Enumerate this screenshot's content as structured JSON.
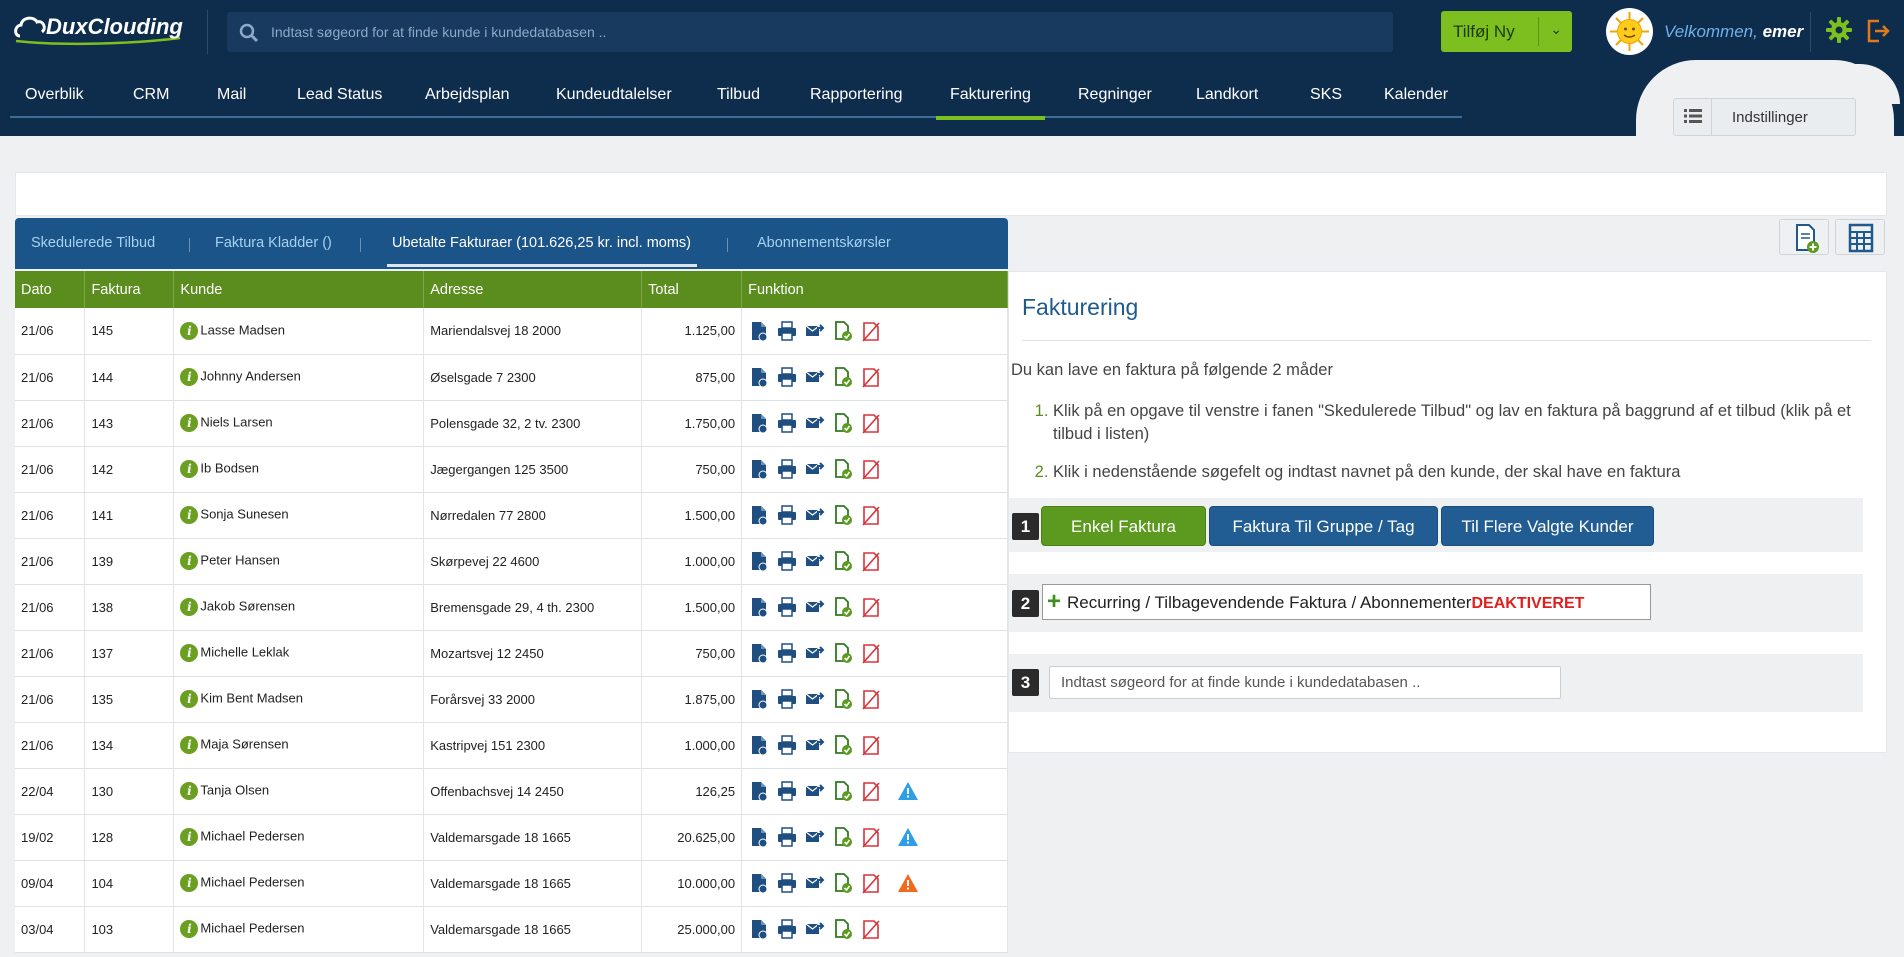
{
  "header": {
    "logo_text": "DuxClouding",
    "search_placeholder": "Indtast søgeord for at finde kunde i kundedatabasen ..",
    "add_new_label": "Tilføj Ny",
    "welcome_prefix": "Velkommen,",
    "welcome_user": "emer"
  },
  "nav": {
    "items": [
      "Overblik",
      "CRM",
      "Mail",
      "Lead Status",
      "Arbejdsplan",
      "Kundeudtalelser",
      "Tilbud",
      "Rapportering",
      "Fakturering",
      "Regninger",
      "Landkort",
      "SKS",
      "Kalender"
    ],
    "active": "Fakturering",
    "settings_label": "Indstillinger"
  },
  "tabs": {
    "items": [
      "Skedulerede Tilbud",
      "Faktura Kladder ()",
      "Ubetalte Fakturaer (101.626,25 kr. incl. moms)",
      "Abonnementskørsler"
    ],
    "active_index": 2
  },
  "table": {
    "headers": [
      "Dato",
      "Faktura",
      "Kunde",
      "Adresse",
      "Total",
      "Funktion"
    ],
    "rows": [
      {
        "dato": "21/06",
        "faktura": "145",
        "kunde": "Lasse Madsen",
        "adresse": "Mariendalsvej 18 2000",
        "total": "1.125,00",
        "warn": ""
      },
      {
        "dato": "21/06",
        "faktura": "144",
        "kunde": "Johnny Andersen",
        "adresse": "Øselsgade 7 2300",
        "total": "875,00",
        "warn": ""
      },
      {
        "dato": "21/06",
        "faktura": "143",
        "kunde": "Niels Larsen",
        "adresse": "Polensgade 32, 2 tv. 2300",
        "total": "1.750,00",
        "warn": ""
      },
      {
        "dato": "21/06",
        "faktura": "142",
        "kunde": "Ib Bodsen",
        "adresse": "Jægergangen 125 3500",
        "total": "750,00",
        "warn": ""
      },
      {
        "dato": "21/06",
        "faktura": "141",
        "kunde": "Sonja Sunesen",
        "adresse": "Nørredalen 77 2800",
        "total": "1.500,00",
        "warn": ""
      },
      {
        "dato": "21/06",
        "faktura": "139",
        "kunde": "Peter Hansen",
        "adresse": "Skørpevej 22 4600",
        "total": "1.000,00",
        "warn": ""
      },
      {
        "dato": "21/06",
        "faktura": "138",
        "kunde": "Jakob Sørensen",
        "adresse": "Bremensgade 29, 4 th. 2300",
        "total": "1.500,00",
        "warn": ""
      },
      {
        "dato": "21/06",
        "faktura": "137",
        "kunde": "Michelle Leklak",
        "adresse": "Mozartsvej 12 2450",
        "total": "750,00",
        "warn": ""
      },
      {
        "dato": "21/06",
        "faktura": "135",
        "kunde": "Kim Bent Madsen",
        "adresse": "Forårsvej 33 2000",
        "total": "1.875,00",
        "warn": ""
      },
      {
        "dato": "21/06",
        "faktura": "134",
        "kunde": "Maja Sørensen",
        "adresse": "Kastripvej 151 2300",
        "total": "1.000,00",
        "warn": ""
      },
      {
        "dato": "22/04",
        "faktura": "130",
        "kunde": "Tanja Olsen",
        "adresse": "Offenbachsvej 14 2450",
        "total": "126,25",
        "warn": "blue"
      },
      {
        "dato": "19/02",
        "faktura": "128",
        "kunde": "Michael Pedersen",
        "adresse": "Valdemarsgade 18 1665",
        "total": "20.625,00",
        "warn": "blue"
      },
      {
        "dato": "09/04",
        "faktura": "104",
        "kunde": "Michael Pedersen",
        "adresse": "Valdemarsgade 18 1665",
        "total": "10.000,00",
        "warn": "orange"
      },
      {
        "dato": "03/04",
        "faktura": "103",
        "kunde": "Michael Pedersen",
        "adresse": "Valdemarsgade 18 1665",
        "total": "25.000,00",
        "warn": ""
      }
    ]
  },
  "invoicing": {
    "title": "Fakturering",
    "intro": "Du kan lave en faktura på følgende 2 måder",
    "steps": [
      "Klik på en opgave til venstre i fanen \"Skedulerede Tilbud\" og lav en faktura på baggrund af et tilbud (klik på et tilbud i listen)",
      "Klik i nedenstående søgefelt og indtast navnet på den kunde, der skal have en faktura"
    ],
    "step_numbers": [
      "1",
      "2",
      "3"
    ],
    "btn_single": "Enkel Faktura",
    "btn_group": "Faktura Til Gruppe / Tag",
    "btn_multi": "Til Flere Valgte Kunder",
    "recurring_label": "Recurring / Tilbagevendende Faktura / Abonnementer",
    "recurring_status": "DEAKTIVERET",
    "search_placeholder": "Indtast søgeord for at finde kunde i kundedatabasen .."
  },
  "colors": {
    "header_bg": "#0e2d4d",
    "accent_green": "#7cbf1e",
    "table_header": "#5b8d1e",
    "tab_bar": "#1a5488",
    "deactivated": "#e0201f"
  }
}
